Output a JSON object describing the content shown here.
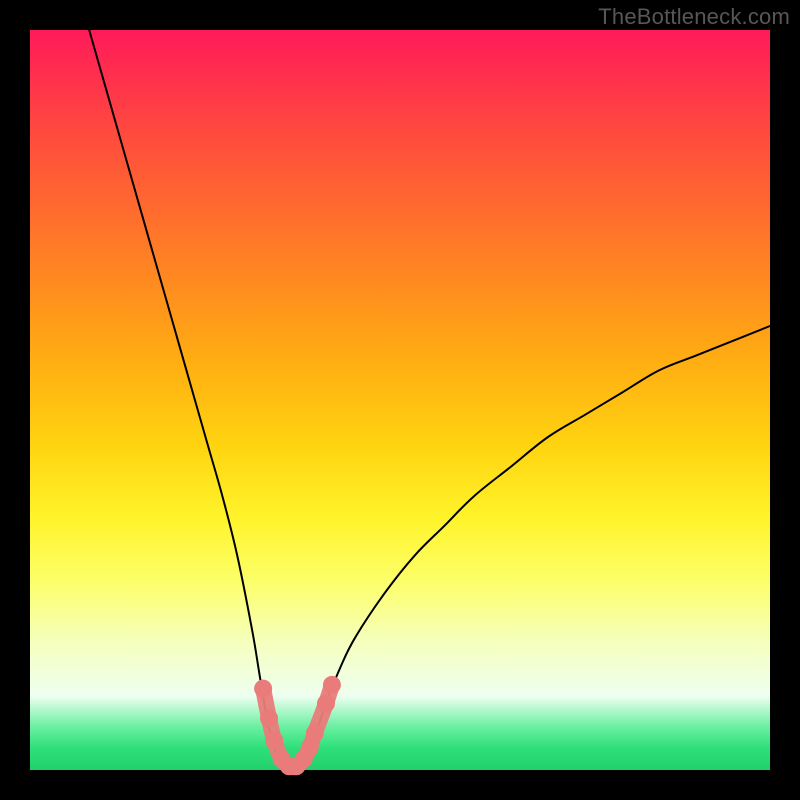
{
  "watermark": "TheBottleneck.com",
  "chart_data": {
    "type": "line",
    "title": "",
    "xlabel": "",
    "ylabel": "",
    "xlim": [
      0,
      100
    ],
    "ylim": [
      0,
      100
    ],
    "grid": false,
    "legend": false,
    "background_gradient_stops": [
      {
        "pos": 0,
        "color": "#ff1a59"
      },
      {
        "pos": 14,
        "color": "#ff4a3e"
      },
      {
        "pos": 34,
        "color": "#ff8a20"
      },
      {
        "pos": 56,
        "color": "#ffd310"
      },
      {
        "pos": 75,
        "color": "#fcff6e"
      },
      {
        "pos": 90,
        "color": "#eefff0"
      },
      {
        "pos": 97,
        "color": "#2fe07a"
      },
      {
        "pos": 100,
        "color": "#21d06b"
      }
    ],
    "series": [
      {
        "name": "bottleneck-curve",
        "color": "#000000",
        "stroke_width": 2,
        "x": [
          8,
          10,
          12,
          14,
          16,
          18,
          20,
          22,
          24,
          26,
          28,
          30,
          31,
          32,
          33,
          34,
          35,
          36,
          37,
          38,
          40,
          42,
          44,
          48,
          52,
          56,
          60,
          65,
          70,
          75,
          80,
          85,
          90,
          95,
          100
        ],
        "values": [
          100,
          93,
          86,
          79,
          72,
          65,
          58,
          51,
          44,
          37,
          29,
          19,
          13,
          7,
          3,
          1,
          0,
          0,
          1,
          3,
          9,
          14,
          18,
          24,
          29,
          33,
          37,
          41,
          45,
          48,
          51,
          54,
          56,
          58,
          60
        ]
      },
      {
        "name": "marker-dots",
        "color": "#e97c7a",
        "type": "scatter",
        "x": [
          31.5,
          32.3,
          33.0,
          34.0,
          35.0,
          36.0,
          37.0,
          37.8,
          38.5,
          40.0,
          40.8
        ],
        "values": [
          11.0,
          7.0,
          4.0,
          1.5,
          0.5,
          0.5,
          1.5,
          3.0,
          5.0,
          9.0,
          11.5
        ]
      }
    ]
  }
}
